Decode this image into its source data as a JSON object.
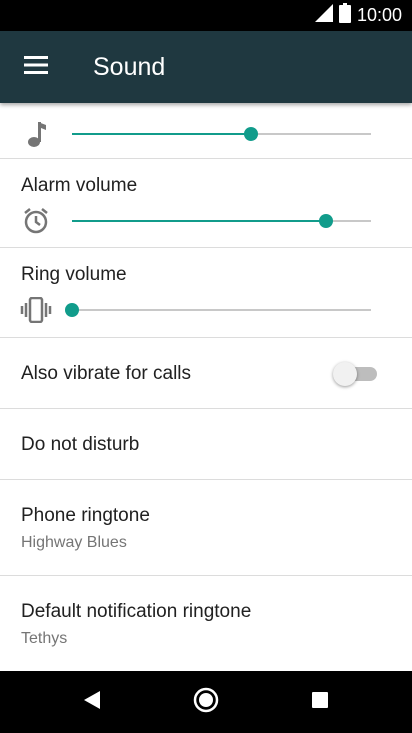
{
  "status_bar": {
    "time": "10:00"
  },
  "toolbar": {
    "title": "Sound"
  },
  "media_volume": {
    "level": 0.6
  },
  "alarm_volume": {
    "label": "Alarm volume",
    "level": 0.85
  },
  "ring_volume": {
    "label": "Ring volume",
    "level": 0.0
  },
  "vibrate_for_calls": {
    "label": "Also vibrate for calls",
    "enabled": false
  },
  "do_not_disturb": {
    "label": "Do not disturb"
  },
  "phone_ringtone": {
    "label": "Phone ringtone",
    "value": "Highway Blues"
  },
  "notification_ringtone": {
    "label": "Default notification ringtone",
    "value": "Tethys"
  },
  "colors": {
    "toolbar": "#1f3840",
    "accent": "#119c8b"
  },
  "icons": {
    "menu": "hamburger-menu-icon",
    "media": "music-note-icon",
    "alarm": "alarm-clock-icon",
    "ring": "vibrate-icon",
    "back": "back-triangle-icon",
    "home": "home-circle-icon",
    "recents": "recents-square-icon"
  }
}
